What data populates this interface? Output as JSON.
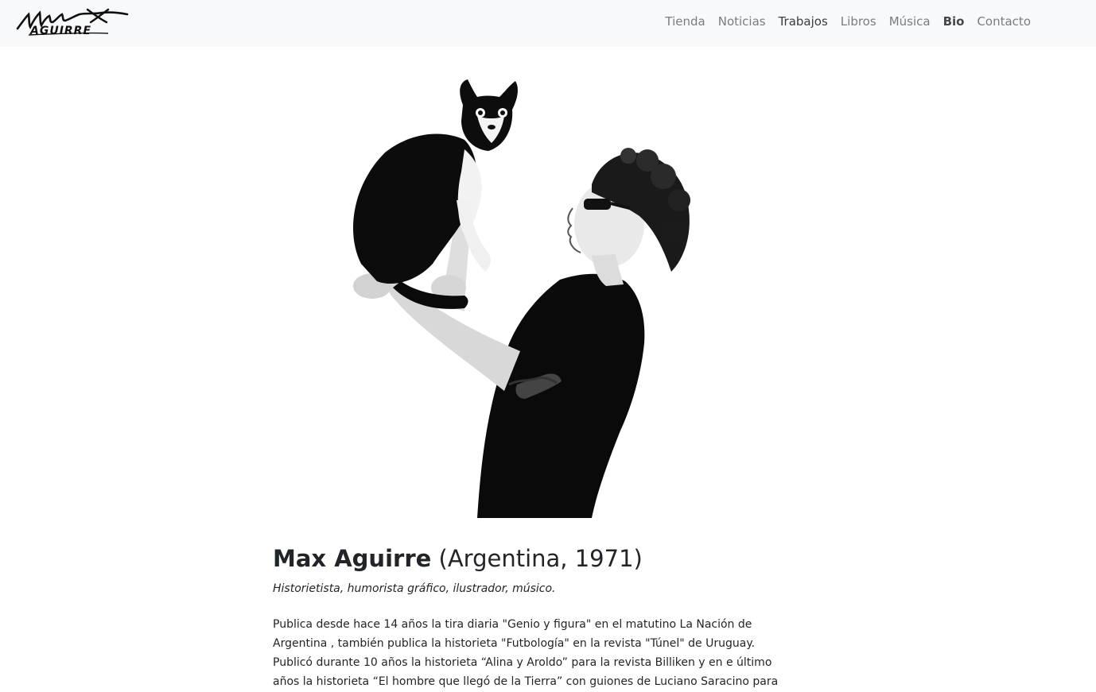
{
  "nav": {
    "brand_alt": "Max Aguirre",
    "items": [
      {
        "label": "Tienda"
      },
      {
        "label": "Noticias"
      },
      {
        "label": "Trabajos"
      },
      {
        "label": "Libros"
      },
      {
        "label": "Música"
      },
      {
        "label": "Bio"
      },
      {
        "label": "Contacto"
      }
    ],
    "active": "Bio"
  },
  "profile": {
    "photo_icon": "portrait-photo",
    "name": "Max Aguirre",
    "origin": "(Argentina, 1971)",
    "roles": "Historietista, humorista gráfico, ilustrador, músico.",
    "bio": "Publica desde hace 14 años la tira diaria \"Genio y figura\" en el matutino La Nación de Argentina , también publica la historieta \"Futbología\" en la revista \"Túnel\" de Uruguay. Publicó durante 10 años la historieta “Alina y Aroldo” para la revista Billiken y en e último años la historieta “El hombre que llegó de la Tierra” con guiones de Luciano Saracino para"
  }
}
